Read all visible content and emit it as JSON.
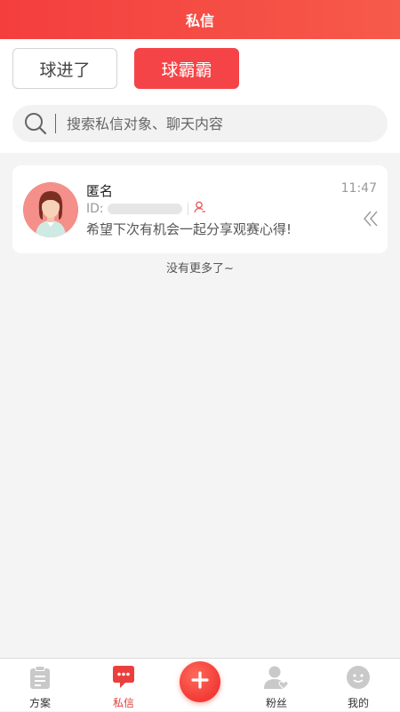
{
  "header": {
    "title": "私信"
  },
  "tabs": {
    "left_label": "球进了",
    "right_label": "球霸霸"
  },
  "search": {
    "placeholder": "搜索私信对象、聊天内容"
  },
  "message": {
    "name": "匿名",
    "id_label": "ID:",
    "text": "希望下次有机会一起分享观赛心得!",
    "time": "11:47"
  },
  "list": {
    "end_text": "没有更多了~"
  },
  "tabbar": {
    "items": [
      {
        "label": "方案",
        "icon": "clipboard-icon"
      },
      {
        "label": "私信",
        "icon": "chat-bubble-icon"
      },
      {
        "label": "",
        "icon": "plus-icon"
      },
      {
        "label": "粉丝",
        "icon": "user-heart-icon"
      },
      {
        "label": "我的",
        "icon": "smile-face-icon"
      }
    ]
  },
  "colors": {
    "accent": "#f54447",
    "active_tab": "#e23c3c",
    "background": "#f4f4f4"
  }
}
